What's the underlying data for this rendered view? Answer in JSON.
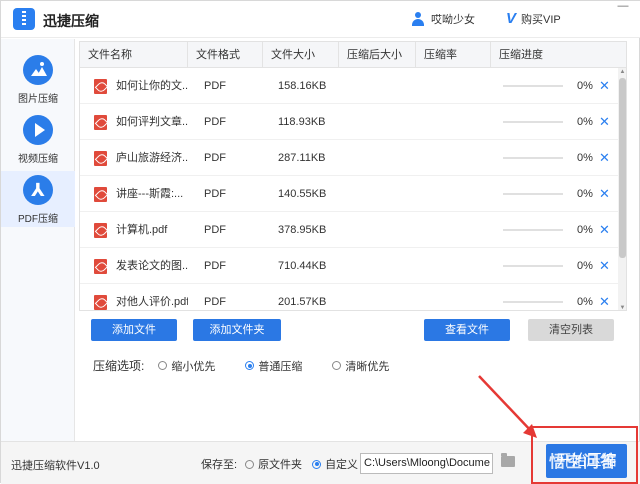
{
  "titlebar": {
    "app_title": "迅捷压缩",
    "username": "哎呦少女",
    "vip_label": "购买VIP",
    "close_glyph": "—"
  },
  "sidebar": {
    "items": [
      {
        "label": "图片压缩",
        "icon": "image-icon"
      },
      {
        "label": "视频压缩",
        "icon": "play-icon"
      },
      {
        "label": "PDF压缩",
        "icon": "pdf-icon",
        "active": true
      }
    ]
  },
  "table": {
    "headers": [
      "文件名称",
      "文件格式",
      "文件大小",
      "压缩后大小",
      "压缩率",
      "压缩进度"
    ],
    "rows": [
      {
        "name": "如何让你的文...",
        "format": "PDF",
        "size": "158.16KB",
        "compressed": "",
        "ratio": "",
        "progress_pct": 0,
        "progress_text": "0%"
      },
      {
        "name": "如何评判文章...",
        "format": "PDF",
        "size": "118.93KB",
        "compressed": "",
        "ratio": "",
        "progress_pct": 0,
        "progress_text": "0%"
      },
      {
        "name": "庐山旅游经济...",
        "format": "PDF",
        "size": "287.11KB",
        "compressed": "",
        "ratio": "",
        "progress_pct": 0,
        "progress_text": "0%"
      },
      {
        "name": "讲座---斯霞:...",
        "format": "PDF",
        "size": "140.55KB",
        "compressed": "",
        "ratio": "",
        "progress_pct": 0,
        "progress_text": "0%"
      },
      {
        "name": "计算机.pdf",
        "format": "PDF",
        "size": "378.95KB",
        "compressed": "",
        "ratio": "",
        "progress_pct": 0,
        "progress_text": "0%"
      },
      {
        "name": "发表论文的图...",
        "format": "PDF",
        "size": "710.44KB",
        "compressed": "",
        "ratio": "",
        "progress_pct": 0,
        "progress_text": "0%"
      },
      {
        "name": "对他人评价.pdf",
        "format": "PDF",
        "size": "201.57KB",
        "compressed": "",
        "ratio": "",
        "progress_pct": 0,
        "progress_text": "0%"
      }
    ],
    "remove_glyph": "✕"
  },
  "buttons": {
    "add_file": "添加文件",
    "add_folder": "添加文件夹",
    "view_file": "查看文件",
    "clear_list": "清空列表"
  },
  "options": {
    "label": "压缩选项:",
    "items": [
      {
        "label": "缩小优先",
        "checked": false
      },
      {
        "label": "普通压缩",
        "checked": true
      },
      {
        "label": "清晰优先",
        "checked": false
      }
    ]
  },
  "footer": {
    "version": "迅捷压缩软件V1.0",
    "save_label": "保存至:",
    "save_options": [
      {
        "label": "原文件夹",
        "checked": false
      },
      {
        "label": "自定义",
        "checked": true
      }
    ],
    "path": "C:\\Users\\Mloong\\Docume",
    "start_button": "开始压缩",
    "watermark": "悟空问答"
  },
  "colors": {
    "accent": "#2b78e4",
    "annotation": "#e53935"
  }
}
